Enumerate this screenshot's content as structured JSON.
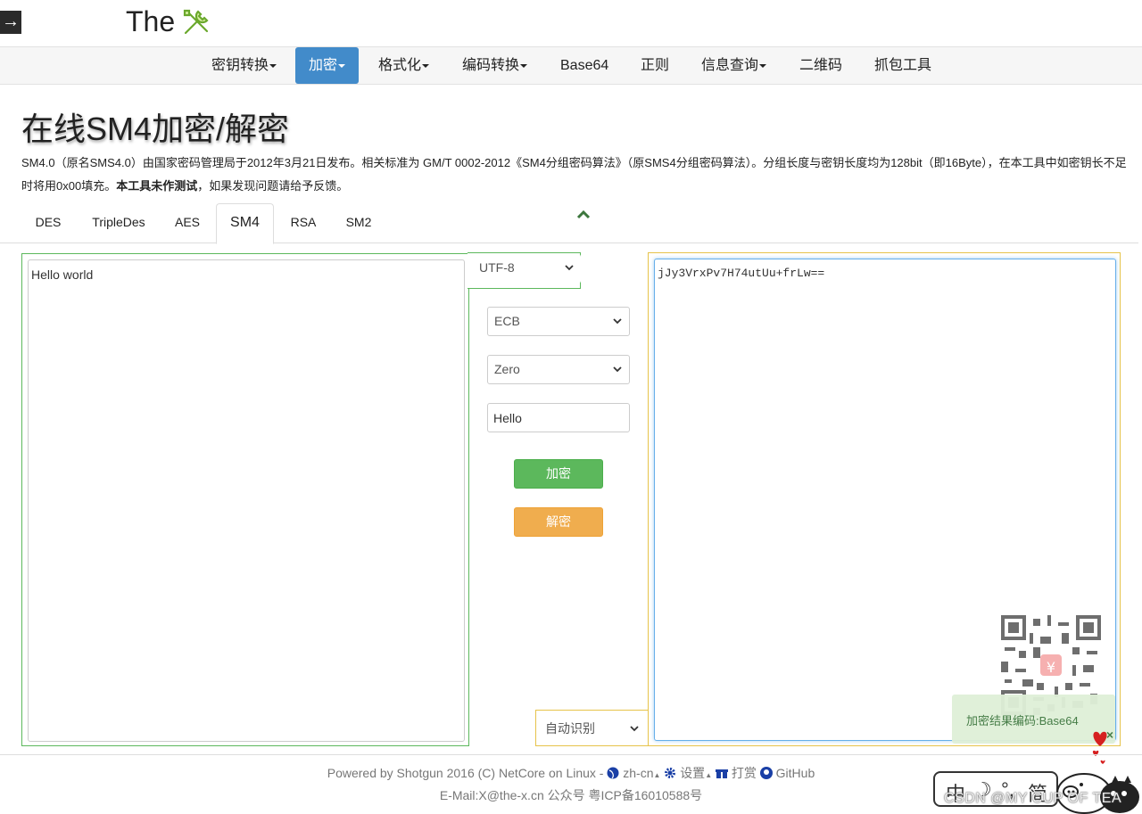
{
  "brand": {
    "text": "The"
  },
  "nav": {
    "items": [
      {
        "label": "密钥转换",
        "dropdown": true
      },
      {
        "label": "加密",
        "dropdown": true,
        "active": true
      },
      {
        "label": "格式化",
        "dropdown": true
      },
      {
        "label": "编码转换",
        "dropdown": true
      },
      {
        "label": "Base64",
        "dropdown": false
      },
      {
        "label": "正则",
        "dropdown": false
      },
      {
        "label": "信息查询",
        "dropdown": true
      },
      {
        "label": "二维码",
        "dropdown": false
      },
      {
        "label": "抓包工具",
        "dropdown": false
      }
    ]
  },
  "page": {
    "title": "在线SM4加密/解密",
    "desc_part1": "SM4.0（原名SMS4.0）由国家密码管理局于2012年3月21日发布。相关标准为 GM/T 0002-2012《SM4分组密码算法》（原SMS4分组密码算法）。分组长度与密钥长度均为128bit（即16Byte），在本工具中如密钥长不足时将用0x00填充。",
    "desc_bold": "本工具未作测试",
    "desc_part2": "，如果发现问题请给予反馈。"
  },
  "tabs": [
    "DES",
    "TripleDes",
    "AES",
    "SM4",
    "RSA",
    "SM2"
  ],
  "active_tab": "SM4",
  "form": {
    "input_text": "Hello world",
    "charset": "UTF-8",
    "mode": "ECB",
    "padding": "Zero",
    "key": "Hello",
    "encrypt_label": "加密",
    "decrypt_label": "解密",
    "output_encoding": "自动识别",
    "output_text": "jJy3VrxPv7H74utUu+frLw=="
  },
  "toast": {
    "message": "加密结果编码:Base64",
    "close": "×"
  },
  "footer": {
    "powered": "Powered by Shotgun 2016 (C) NetCore on Linux - ",
    "lang": "zh-cn",
    "settings": "设置",
    "donate": "打赏",
    "github": "GitHub",
    "line2": "E-Mail:X@the-x.cn 公众号 粤ICP备16010588号"
  },
  "lang_widget": [
    "中",
    "☽",
    "°,",
    "简"
  ],
  "watermark": "CSDN @MY CUP OF TEA",
  "colors": {
    "nav_active": "#428bca",
    "encrypt_button": "#5cb85c",
    "decrypt_button": "#f0ad4e",
    "input_border": "#5cb85c",
    "output_border": "#e6c34a",
    "toast_bg": "#dff0d8"
  },
  "icons": [
    "arrow-right-icon",
    "tools-icon",
    "chevron-up-icon",
    "chevron-down-icon",
    "globe-icon",
    "gear-icon",
    "gift-icon",
    "github-icon",
    "qr-code-icon",
    "hearts-icon",
    "pig-mascot-icon"
  ]
}
